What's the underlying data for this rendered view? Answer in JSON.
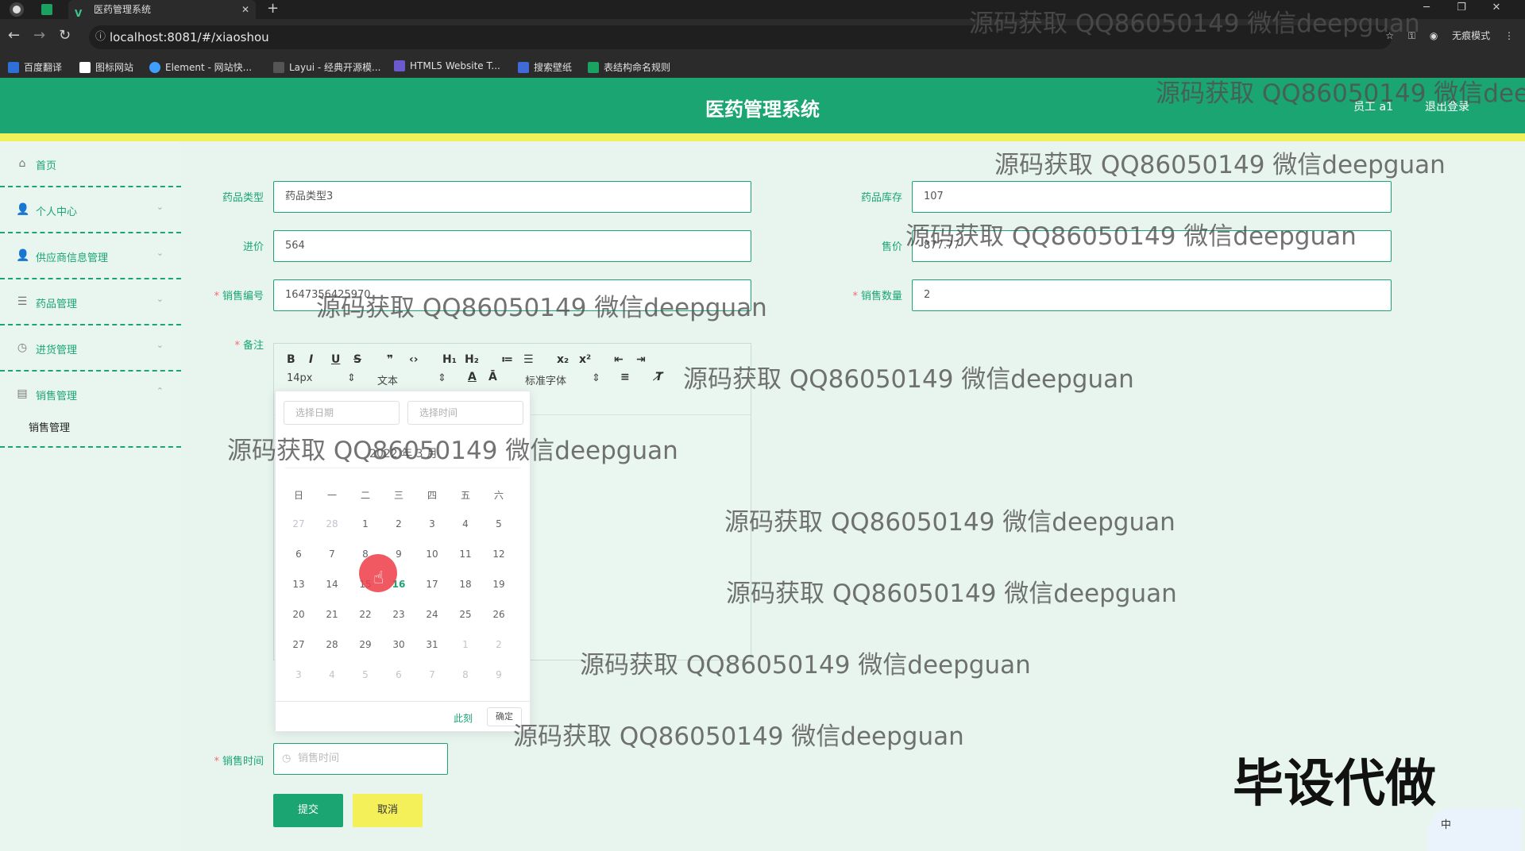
{
  "browser": {
    "tab_title": "医药管理系统",
    "url": "localhost:8081/#/xiaoshou",
    "incognito_label": "无痕模式",
    "bookmarks": [
      "百度翻译",
      "图标网站",
      "Element - 网站快...",
      "Layui - 经典开源模...",
      "HTML5 Website T...",
      "搜索壁纸",
      "表结构命名规则"
    ]
  },
  "header": {
    "title": "医药管理系统",
    "user": "员工 a1",
    "logout": "退出登录"
  },
  "sidebar": {
    "items": [
      {
        "label": "首页",
        "icon": "home-icon"
      },
      {
        "label": "个人中心",
        "icon": "user-icon"
      },
      {
        "label": "供应商信息管理",
        "icon": "supplier-icon"
      },
      {
        "label": "药品管理",
        "icon": "list-icon"
      },
      {
        "label": "进货管理",
        "icon": "purchase-icon"
      },
      {
        "label": "销售管理",
        "icon": "sales-icon"
      }
    ],
    "sub_item": "销售管理"
  },
  "form": {
    "drug_type": {
      "label": "药品类型",
      "value": "药品类型3"
    },
    "stock": {
      "label": "药品库存",
      "value": "107"
    },
    "cost": {
      "label": "进价",
      "value": "564"
    },
    "price": {
      "label": "售价",
      "value": "877.77"
    },
    "sale_no": {
      "label": "销售编号",
      "value": "1647356425970"
    },
    "quantity": {
      "label": "销售数量",
      "value": "2"
    },
    "remark": {
      "label": "备注"
    },
    "sale_time": {
      "label": "销售时间",
      "placeholder": "销售时间"
    },
    "submit": "提交",
    "cancel": "取消"
  },
  "editor": {
    "font_size": "14px",
    "text_type": "文本",
    "font_family": "标准字体"
  },
  "picker": {
    "date_placeholder": "选择日期",
    "time_placeholder": "选择时间",
    "header": "2022 年 3 月",
    "weekdays": [
      "日",
      "一",
      "二",
      "三",
      "四",
      "五",
      "六"
    ],
    "weeks": [
      [
        "27",
        "28",
        "1",
        "2",
        "3",
        "4",
        "5"
      ],
      [
        "6",
        "7",
        "8",
        "9",
        "10",
        "11",
        "12"
      ],
      [
        "13",
        "14",
        "15",
        "16",
        "17",
        "18",
        "19"
      ],
      [
        "20",
        "21",
        "22",
        "23",
        "24",
        "25",
        "26"
      ],
      [
        "27",
        "28",
        "29",
        "30",
        "31",
        "1",
        "2"
      ],
      [
        "3",
        "4",
        "5",
        "6",
        "7",
        "8",
        "9"
      ]
    ],
    "today": "16",
    "now": "此刻",
    "ok": "确定"
  },
  "watermark": "源码获取 QQ86050149 微信deepguan",
  "overlay_text": "毕设代做",
  "ime_label": "中",
  "colors": {
    "primary": "#1aa573",
    "accent_yellow": "#f1f05a",
    "danger": "#f56c6c"
  }
}
